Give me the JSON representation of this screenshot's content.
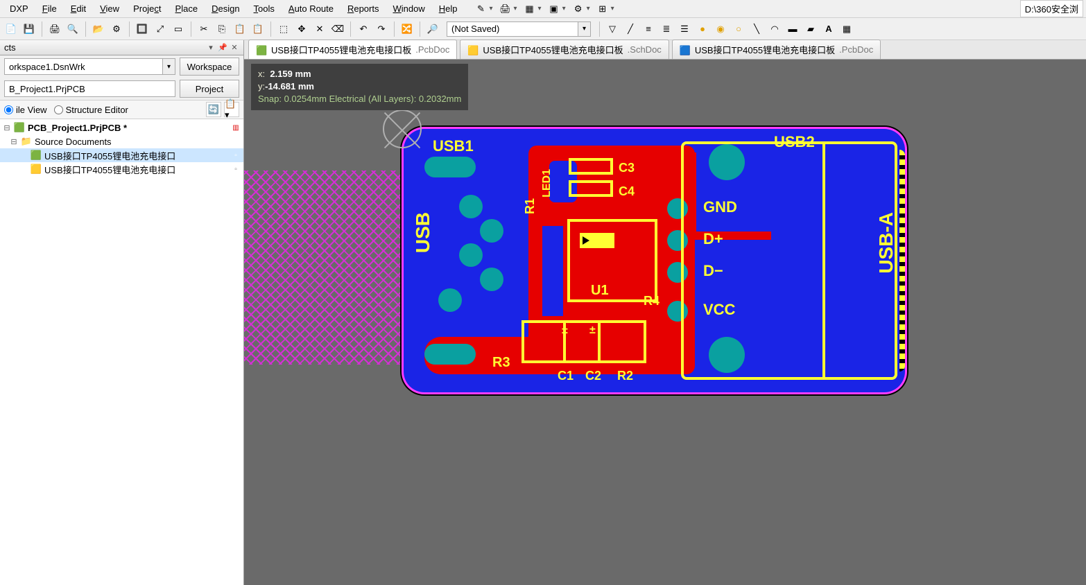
{
  "menu": {
    "items": [
      "DXP",
      "File",
      "Edit",
      "View",
      "Project",
      "Place",
      "Design",
      "Tools",
      "Auto Route",
      "Reports",
      "Window",
      "Help"
    ],
    "underlines": [
      "X",
      "F",
      "E",
      "V",
      "C",
      "P",
      "D",
      "T",
      "A",
      "R",
      "W",
      "H"
    ],
    "path_field": "D:\\360安全浏"
  },
  "toolbar": {
    "document_dropdown": "(Not Saved)"
  },
  "projects_panel": {
    "title": "cts",
    "workspace_combo": "orkspace1.DsnWrk",
    "workspace_btn": "Workspace",
    "project_field": "B_Project1.PrjPCB",
    "project_btn": "Project",
    "view_radio1": "ile View",
    "view_radio2": "Structure Editor",
    "tree": {
      "root": "PCB_Project1.PrjPCB *",
      "folder": "Source Documents",
      "doc1": "USB接口TP4055锂电池充电接口",
      "doc2": "USB接口TP4055锂电池充电接口"
    }
  },
  "doc_tabs": [
    {
      "name": "USB接口TP4055锂电池充电接口板",
      "ext": ".PcbDoc",
      "icon": "pcb"
    },
    {
      "name": "USB接口TP4055锂电池充电接口板",
      "ext": ".SchDoc",
      "icon": "sch"
    },
    {
      "name": "USB接口TP4055锂电池充电接口板",
      "ext": ".PcbDoc",
      "icon": "pcb2"
    }
  ],
  "hud": {
    "x_label": "x:",
    "x_val": "2.159  mm",
    "y_label": "y:",
    "y_val": "-14.681 mm",
    "snap_line": "Snap: 0.0254mm Electrical (All Layers): 0.2032mm"
  },
  "board": {
    "labels": {
      "usb1": "USB1",
      "usb2": "USB2",
      "gnd": "GND",
      "dplus": "D+",
      "dminus": "D−",
      "vcc": "VCC",
      "usb_side": "USB",
      "usb_a": "USB-A",
      "r1": "R1",
      "r3": "R3",
      "r4": "R4",
      "r2": "R2",
      "c1": "C1",
      "c2": "C2",
      "c3": "C3",
      "c4": "C4",
      "u1": "U1",
      "led1": "LED1"
    }
  }
}
